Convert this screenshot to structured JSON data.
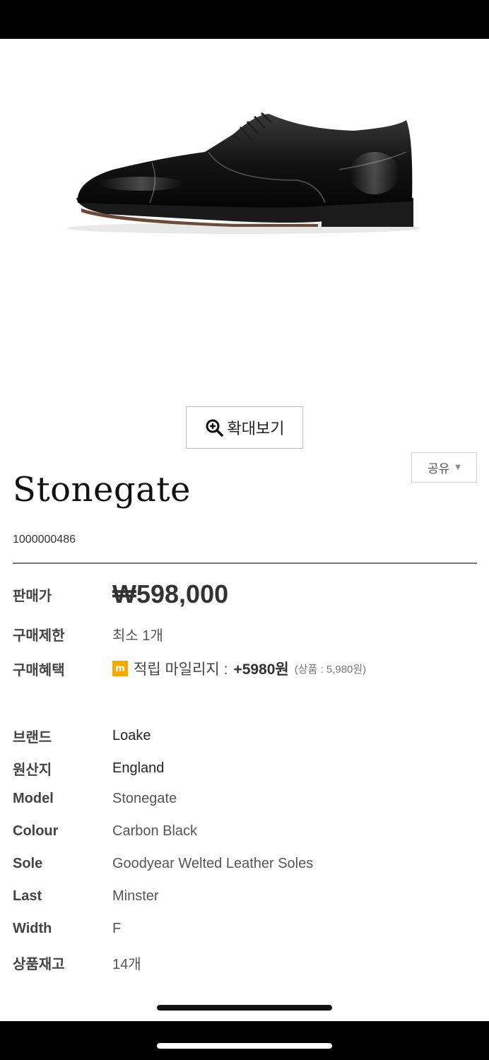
{
  "zoom_button": {
    "label": "확대보기",
    "icon": "zoom-in-icon"
  },
  "share_button": {
    "label": "공유",
    "icon": "chevron-down-icon"
  },
  "product": {
    "name": "Stonegate",
    "code": "1000000486",
    "image_alt_icon": "oxford-shoe-image"
  },
  "purchase": {
    "price_label": "판매가",
    "price": "₩598,000",
    "limit_label": "구매제한",
    "limit_value": "최소 1개",
    "benefit_label": "구매혜택",
    "benefit_badge": "m",
    "benefit_text": "적립 마일리지 :",
    "benefit_amount": "+5980원",
    "benefit_note": "(상품 : 5,980원)"
  },
  "specs": [
    {
      "label": "브랜드",
      "value": "Loake"
    },
    {
      "label": "원산지",
      "value": "England"
    },
    {
      "label": "Model",
      "value": "Stonegate"
    },
    {
      "label": "Colour",
      "value": "Carbon Black"
    },
    {
      "label": "Sole",
      "value": "Goodyear Welted Leather Soles"
    },
    {
      "label": "Last",
      "value": "Minster"
    },
    {
      "label": "Width",
      "value": "F"
    },
    {
      "label": "상품재고",
      "value": "14개"
    }
  ],
  "colors": {
    "badge": "#f5a800",
    "divider": "#777777",
    "background": "#ffffff"
  }
}
